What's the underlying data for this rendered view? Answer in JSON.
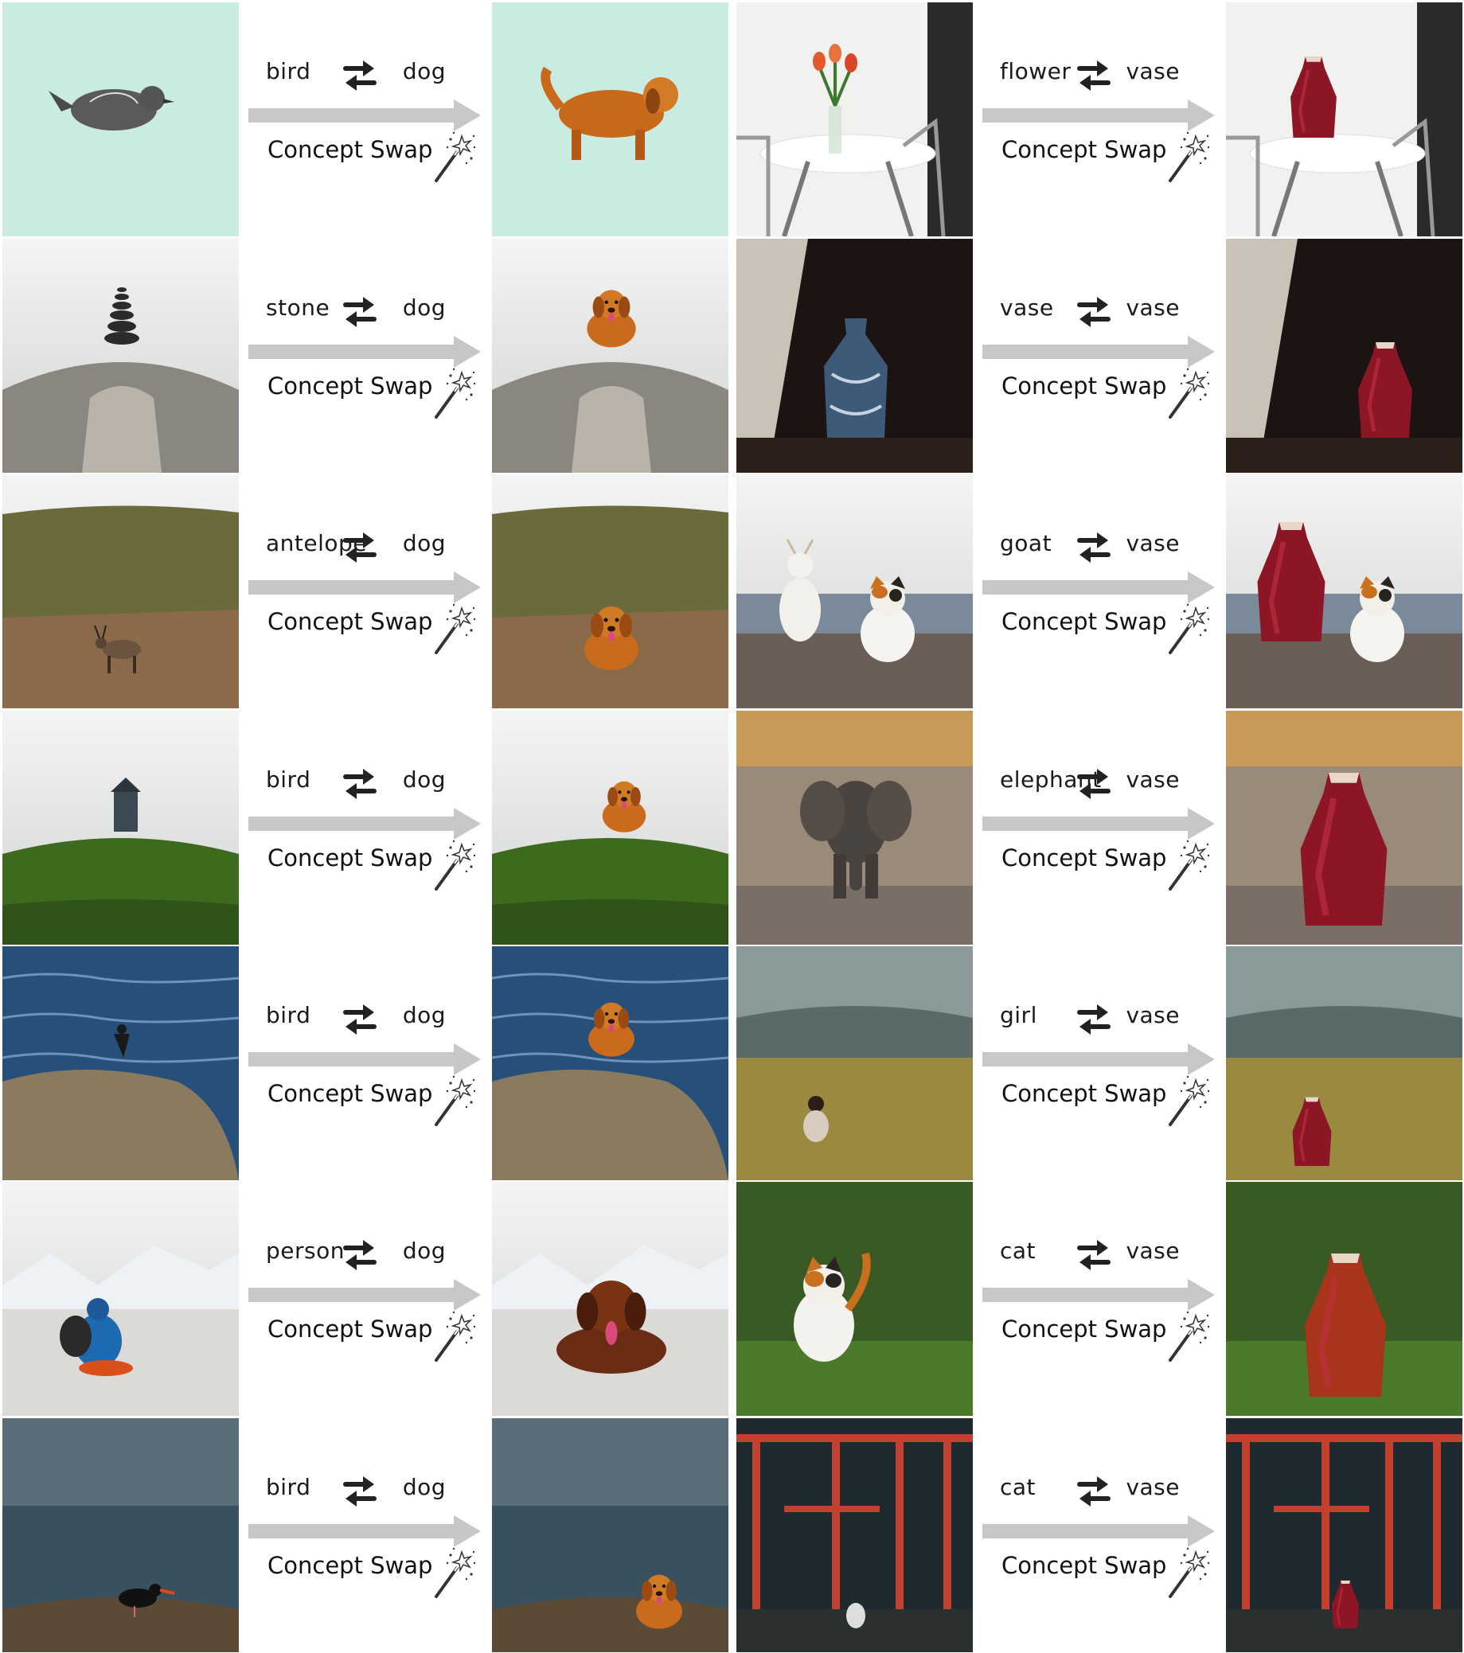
{
  "figure": {
    "operation_label": "Concept Swap",
    "rows": [
      {
        "left": {
          "source": "bird",
          "target": "dog",
          "input_scene": "bird illustration on mint background",
          "output_scene": "dog illustration on mint background"
        },
        "right": {
          "source": "flower",
          "target": "vase",
          "input_scene": "tulips on white dining table",
          "output_scene": "red vase on white dining table"
        }
      },
      {
        "left": {
          "source": "stone",
          "target": "dog",
          "input_scene": "stacked stones on misty rock",
          "output_scene": "dog sitting on misty rock"
        },
        "right": {
          "source": "vase",
          "target": "vase",
          "input_scene": "blue porcelain vase by curtain",
          "output_scene": "red vase by curtain"
        }
      },
      {
        "left": {
          "source": "antelope",
          "target": "dog",
          "input_scene": "antelope on grassy hill",
          "output_scene": "dog on grassy hill"
        },
        "right": {
          "source": "goat",
          "target": "vase",
          "input_scene": "goat and calico cat by the sea",
          "output_scene": "red vase and calico cat by the sea"
        }
      },
      {
        "left": {
          "source": "bird",
          "target": "dog",
          "input_scene": "small hut on green hill",
          "output_scene": "dog on green hill"
        },
        "right": {
          "source": "elephant",
          "target": "vase",
          "input_scene": "elephant on dusty plain at sunset",
          "output_scene": "red vase on dusty plain at sunset"
        }
      },
      {
        "left": {
          "source": "bird",
          "target": "dog",
          "input_scene": "cormorant on boulder in sea",
          "output_scene": "dog on boulder in sea"
        },
        "right": {
          "source": "girl",
          "target": "vase",
          "input_scene": "girl sitting in golden field",
          "output_scene": "red vase in golden field"
        }
      },
      {
        "left": {
          "source": "person",
          "target": "dog",
          "input_scene": "hiker before snowy mountains",
          "output_scene": "dog before snowy mountains"
        },
        "right": {
          "source": "cat",
          "target": "vase",
          "input_scene": "calico cat in green grass",
          "output_scene": "red vase in green grass"
        }
      },
      {
        "left": {
          "source": "bird",
          "target": "dog",
          "input_scene": "oystercatcher on rocky shore",
          "output_scene": "dog on rocky shore"
        },
        "right": {
          "source": "cat",
          "target": "vase",
          "input_scene": "red torii gates shrine",
          "output_scene": "red vase at torii shrine"
        }
      }
    ]
  },
  "colors": {
    "arrow": "#c7c7c7",
    "vase_red": "#8c1626",
    "dog_orange": "#c96a1c",
    "mint": "#c9ebe0",
    "torii_red": "#c2412e"
  }
}
